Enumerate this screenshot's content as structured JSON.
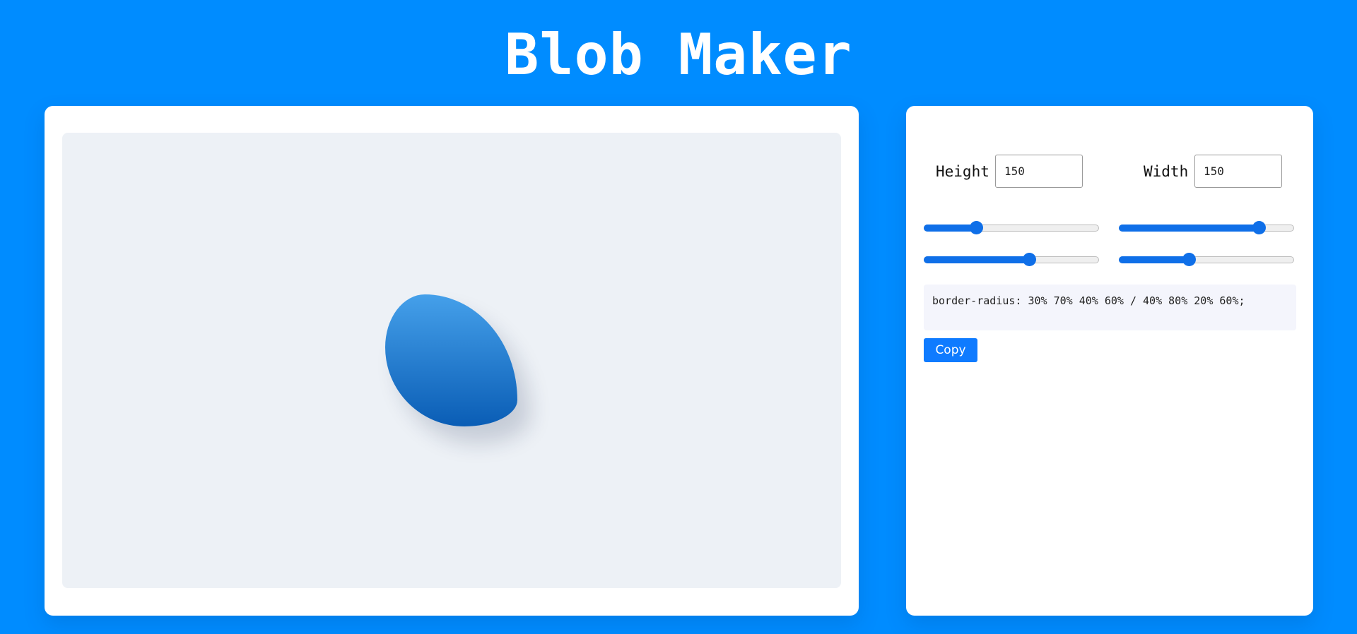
{
  "header": {
    "title": "Blob Maker"
  },
  "preview": {
    "blob_gradient_top": "#45a0ea",
    "blob_gradient_bottom": "#0a5db5",
    "border_radius": "30% 70% 40% 60% / 40% 80% 20% 60%"
  },
  "controls": {
    "height_label": "Height",
    "height_value": "150",
    "width_label": "Width",
    "width_value": "150",
    "sliders": [
      {
        "value": 30
      },
      {
        "value": 80
      },
      {
        "value": 60
      },
      {
        "value": 40
      }
    ],
    "css_output": "border-radius: 30% 70% 40% 60% / 40% 80% 20% 60%;",
    "copy_label": "Copy"
  },
  "colors": {
    "background": "#008cff",
    "accent": "#0f6fe8",
    "button": "#0f7bff"
  }
}
